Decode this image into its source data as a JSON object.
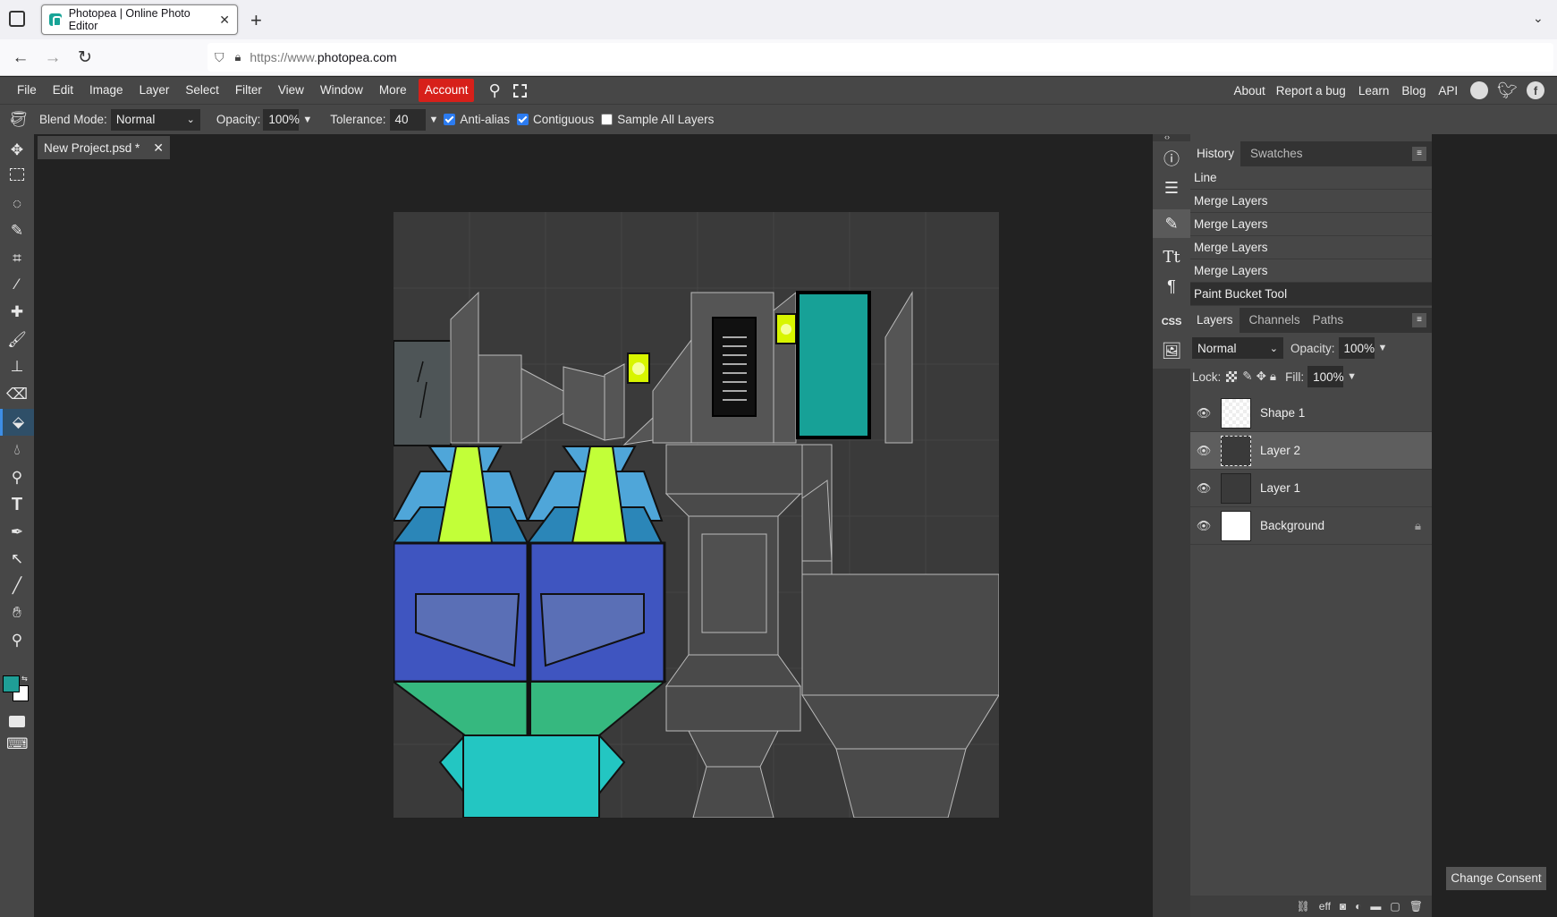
{
  "browser": {
    "tab_title": "Photopea | Online Photo Editor",
    "url_prefix": "https://www.",
    "url_domain": "photopea.com"
  },
  "menu": {
    "items": [
      "File",
      "Edit",
      "Image",
      "Layer",
      "Select",
      "Filter",
      "View",
      "Window",
      "More"
    ],
    "account": "Account",
    "right_links": [
      "About",
      "Report a bug",
      "Learn",
      "Blog",
      "API"
    ]
  },
  "options": {
    "blend_label": "Blend Mode:",
    "blend_value": "Normal",
    "opacity_label": "Opacity:",
    "opacity_value": "100%",
    "tolerance_label": "Tolerance:",
    "tolerance_value": "40",
    "antialias_label": "Anti-alias",
    "antialias_checked": true,
    "contiguous_label": "Contiguous",
    "contiguous_checked": true,
    "sample_label": "Sample All Layers",
    "sample_checked": false
  },
  "document": {
    "tab_title": "New Project.psd *"
  },
  "history": {
    "tabs": [
      "History",
      "Swatches"
    ],
    "items": [
      "Line",
      "Merge Layers",
      "Merge Layers",
      "Merge Layers",
      "Merge Layers",
      "Paint Bucket Tool"
    ]
  },
  "layers": {
    "tabs": [
      "Layers",
      "Channels",
      "Paths"
    ],
    "blend": "Normal",
    "opacity_label": "Opacity:",
    "opacity_value": "100%",
    "lock_label": "Lock:",
    "fill_label": "Fill:",
    "fill_value": "100%",
    "items": [
      {
        "name": "Shape 1",
        "selected": false
      },
      {
        "name": "Layer 2",
        "selected": true
      },
      {
        "name": "Layer 1",
        "selected": false
      },
      {
        "name": "Background",
        "selected": false,
        "locked": true
      }
    ]
  },
  "footer": {
    "change_consent": "Change Consent",
    "eff": "eff"
  },
  "colors": {
    "foreground": "#1f9e96",
    "background": "#ffffff",
    "accent": "#d7201a"
  }
}
